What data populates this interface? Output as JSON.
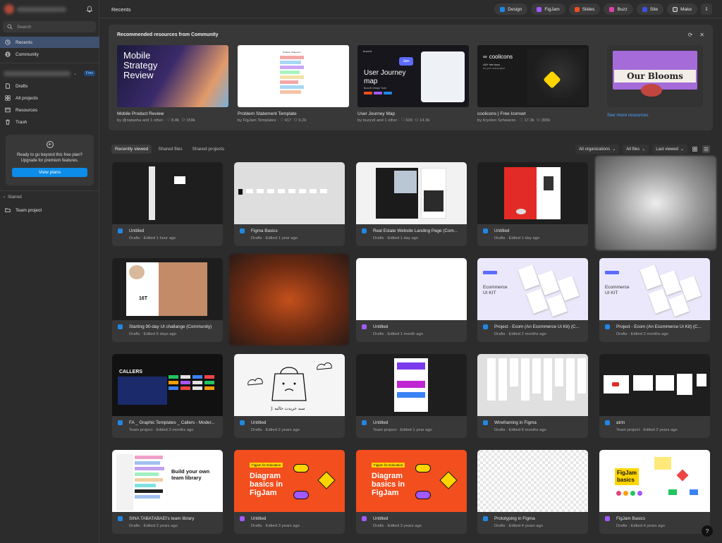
{
  "sidebar": {
    "search_placeholder": "Search",
    "nav": [
      {
        "label": "Recents",
        "icon": "clock-icon"
      },
      {
        "label": "Community",
        "icon": "globe-icon"
      },
      {
        "label": "Drafts",
        "icon": "draft-icon"
      },
      {
        "label": "All projects",
        "icon": "grid-icon"
      },
      {
        "label": "Resources",
        "icon": "resources-icon"
      },
      {
        "label": "Trash",
        "icon": "trash-icon"
      }
    ],
    "team_badge": "Free",
    "upgrade_text_1": "Ready to go beyond this free plan?",
    "upgrade_text_2": "Upgrade for premium features.",
    "upgrade_button": "View plans",
    "starred_label": "Starred",
    "starred_items": [
      {
        "label": "Team project"
      }
    ]
  },
  "header": {
    "title": "Recents",
    "pills": [
      "Design",
      "FigJam",
      "Slides",
      "Buzz",
      "Site",
      "Make"
    ]
  },
  "colors": {
    "design": "#1e88e5",
    "figjam": "#a259ff",
    "slides": "#f24e1e",
    "buzz": "#e13ea8",
    "site": "#3f51e5",
    "make": "#dddddd",
    "accent": "#0d8ce9"
  },
  "recommended": {
    "title": "Recommended resources from Community",
    "see_more": "See more resources",
    "cards": [
      {
        "name": "Mobile Product Review",
        "by": "by @natasha and 1 other",
        "likes": "8.8k",
        "users": "159k",
        "thumb_text": [
          "Mobile",
          "Strategy",
          "Review"
        ]
      },
      {
        "name": "Problem Statement Template",
        "by": "by FigJam Templates",
        "likes": "417",
        "users": "9.2k",
        "thumb_text": [
          "Problem Statement"
        ]
      },
      {
        "name": "User Journey Map",
        "by": "by buzzvil and 1 other",
        "likes": "639",
        "users": "14.3k",
        "thumb_text": [
          "User Journey",
          "map",
          "Buzzvil Design Tools",
          "buzzvil",
          "Jam"
        ]
      },
      {
        "name": "coolicons | Free Iconset",
        "by": "by Kryston Schwarze",
        "likes": "17.3k",
        "users": "390k",
        "thumb_text": [
          "coolicons",
          "440+ free icons",
          "for your next project"
        ]
      },
      {
        "name": "",
        "by": "",
        "likes": "",
        "users": "",
        "thumb_text": [
          "Our Blooms"
        ]
      }
    ]
  },
  "tabs": [
    "Recently viewed",
    "Shared files",
    "Shared projects"
  ],
  "filters": [
    "All organizations",
    "All files",
    "Last viewed"
  ],
  "files": [
    {
      "name": "Untitled",
      "meta": "Drafts · Edited 1 hour ago",
      "type": "design"
    },
    {
      "name": "Figma Basics",
      "meta": "Drafts · Edited 1 year ago",
      "type": "design"
    },
    {
      "name": "Real Estate Website Landing Page (Com...",
      "meta": "Drafts · Edited 1 day ago",
      "type": "design"
    },
    {
      "name": "Untitled",
      "meta": "Drafts · Edited 1 day ago",
      "type": "design"
    },
    {
      "name": "",
      "meta": "",
      "type": "blur"
    },
    {
      "name": "Starting 90-day UI challange (Community)",
      "meta": "Drafts · Edited 6 days ago",
      "type": "design"
    },
    {
      "name": "",
      "meta": "",
      "type": "blur"
    },
    {
      "name": "Untitled",
      "meta": "Drafts · Edited 1 month ago",
      "type": "figjam"
    },
    {
      "name": "Project - Ecom (An Ecommerce Ui Kit) (C...",
      "meta": "Drafts · Edited 2 months ago",
      "type": "design"
    },
    {
      "name": "Project - Ecom (An Ecommerce Ui Kit) (C...",
      "meta": "Drafts · Edited 2 months ago",
      "type": "design"
    },
    {
      "name": "FA _ Graphic Templates _ Callers - Moder...",
      "meta": "Team project · Edited 3 months ago",
      "type": "design"
    },
    {
      "name": "Untitled",
      "meta": "Drafts · Edited 2 years ago",
      "type": "design"
    },
    {
      "name": "Untitled",
      "meta": "Team project · Edited 1 year ago",
      "type": "design"
    },
    {
      "name": "Wireframing in Figma",
      "meta": "Drafts · Edited 8 months ago",
      "type": "design"
    },
    {
      "name": "atrin",
      "meta": "Team project · Edited 2 years ago",
      "type": "design"
    },
    {
      "name": "SINA TABATABAEI's team library",
      "meta": "Drafts · Edited 2 years ago",
      "type": "design"
    },
    {
      "name": "Untitled",
      "meta": "Drafts · Edited 3 years ago",
      "type": "figjam"
    },
    {
      "name": "Untitled",
      "meta": "Drafts · Edited 3 years ago",
      "type": "figjam"
    },
    {
      "name": "Prototyping in Figma",
      "meta": "Drafts · Edited 4 years ago",
      "type": "design"
    },
    {
      "name": "FigJam Basics",
      "meta": "Drafts · Edited 4 years ago",
      "type": "figjam"
    }
  ],
  "thumb_text": {
    "ui_challenge": "16T",
    "callers": "CALLERS",
    "persian_caption": "سبد خریدت خالیه :(",
    "team_library": [
      "Build your own",
      "team library"
    ],
    "figjam_edu_tag": "Figjam for Education",
    "figjam_edu": [
      "Diagram",
      "basics in",
      "FigJam"
    ],
    "figjam_basics": [
      "FigJam",
      "basics"
    ],
    "ecom_title": [
      "Ecommerce",
      "UI KIT"
    ]
  },
  "help_label": "?"
}
